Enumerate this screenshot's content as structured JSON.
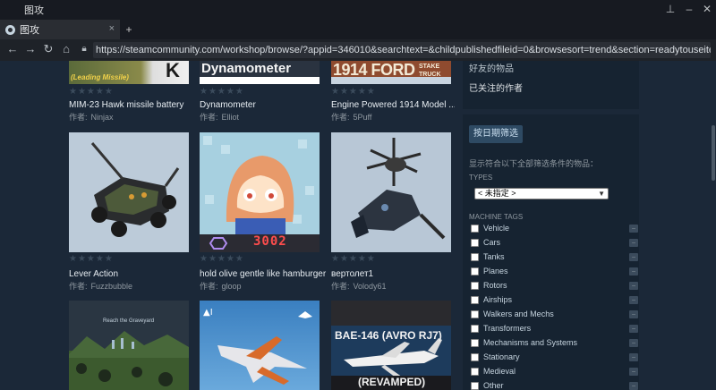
{
  "window": {
    "title": "图攻"
  },
  "tab": {
    "label": "图攻",
    "close": "×",
    "new_tab": "+"
  },
  "nav": {
    "url": "https://steamcommunity.com/workshop/browse/?appid=346010&searchtext=&childpublishedfileid=0&browsesort=trend&section=readytouseitems&created"
  },
  "items_top": [
    {
      "title": "MIM-23 Hawk missile battery",
      "author_prefix": "作者:",
      "author": "Ninjax",
      "thumb_text": "(Leading Missile)"
    },
    {
      "title": "Dynamometer",
      "author_prefix": "作者:",
      "author": "Elliot",
      "thumb_text": "Dynamometer"
    },
    {
      "title": "Engine Powered 1914 Model ...",
      "author_prefix": "作者:",
      "author": "5Puff",
      "thumb_text": "1914 FORD",
      "thumb_text2": "STAKE TRUCK"
    }
  ],
  "items_mid": [
    {
      "title": "Lever Action",
      "author_prefix": "作者:",
      "author": "Fuzzbubble"
    },
    {
      "title": "hold olive gentle like hamburger",
      "author_prefix": "作者:",
      "author": "gloop",
      "thumb_number": "3002"
    },
    {
      "title": "вертолет1",
      "author_prefix": "作者:",
      "author": "Volody61"
    }
  ],
  "items_bottom": [
    {
      "thumb_text": "Reach the Graveyard"
    },
    {
      "thumb_text": ""
    },
    {
      "thumb_text": "BAE-146 (AVRO RJ7)",
      "thumb_text2": "(REVAMPED)"
    }
  ],
  "stars": "★★★★★",
  "sidebar": {
    "top_link_1": "好友的物品",
    "top_link_2": "已关注的作者",
    "date_button": "按日期筛选",
    "filter_caption": "显示符合以下全部筛选条件的物品：",
    "types_header": "TYPES",
    "types_selected": "< 未指定 >",
    "machine_tags_header": "MACHINE TAGS",
    "tags": [
      "Vehicle",
      "Cars",
      "Tanks",
      "Planes",
      "Rotors",
      "Airships",
      "Walkers and Mechs",
      "Transformers",
      "Mechanisms and Systems",
      "Stationary",
      "Medieval",
      "Other"
    ]
  },
  "colors": {
    "background": "#1b2838",
    "panel": "#162331",
    "accent_button": "#2e4a63"
  }
}
